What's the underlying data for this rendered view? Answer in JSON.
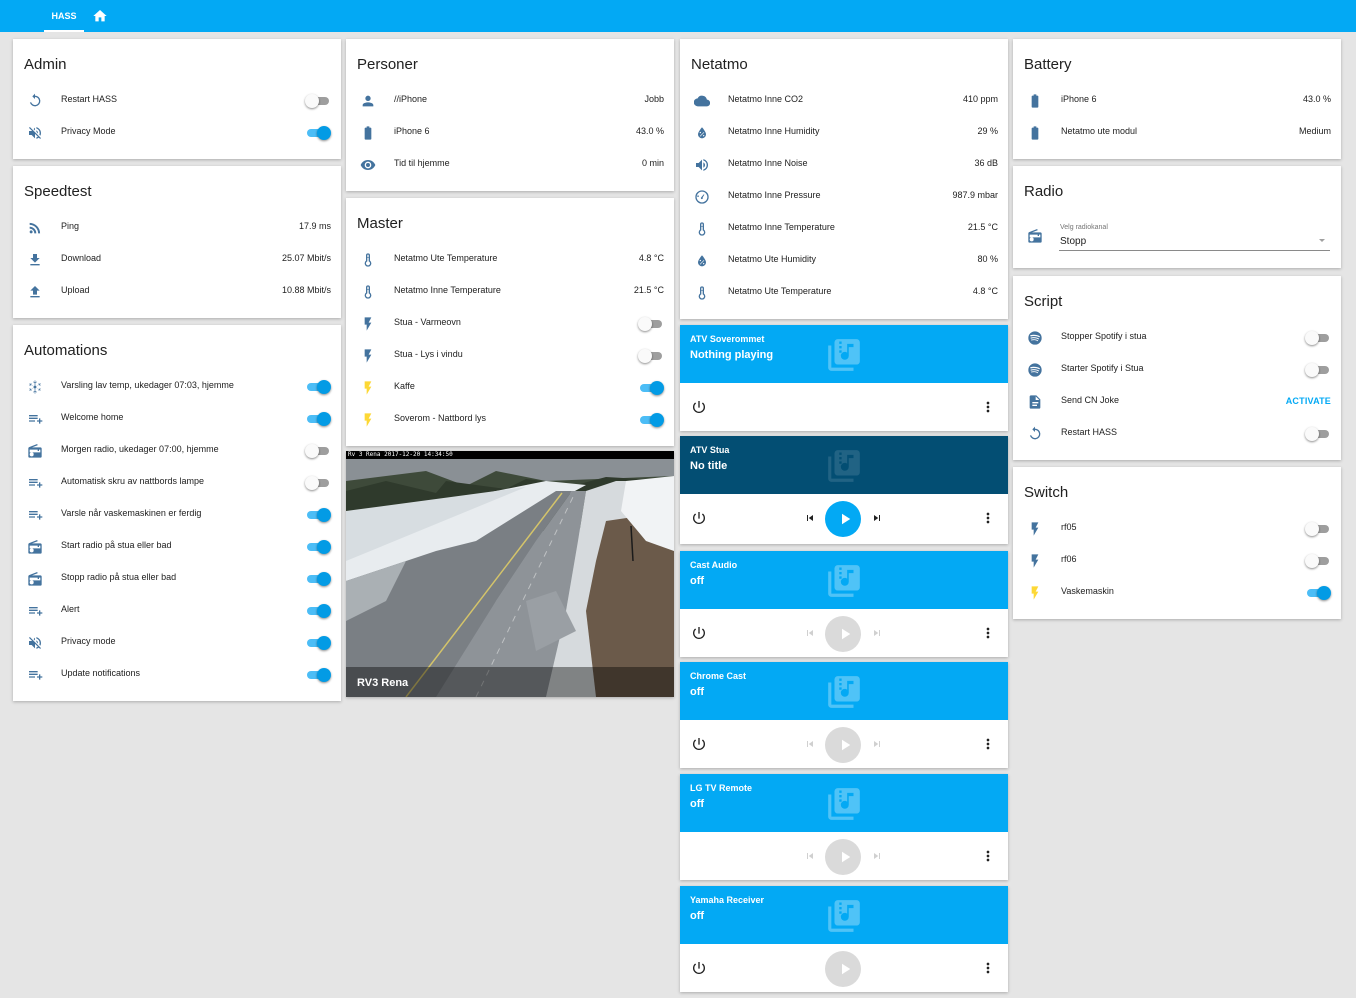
{
  "header": {
    "tab_label": "HASS",
    "home_icon": "home-icon",
    "bar_color": "#03a9f4"
  },
  "colors": {
    "icon": "#44739e",
    "accent": "#03a9f4",
    "toggle_on": "#039be5",
    "lightning_on": "#fdd835"
  },
  "admin": {
    "title": "Admin",
    "rows": [
      {
        "label": "Restart HASS",
        "icon": "restart-icon",
        "on": false
      },
      {
        "label": "Privacy Mode",
        "icon": "volume-off-icon",
        "on": true
      }
    ]
  },
  "speedtest": {
    "title": "Speedtest",
    "rows": [
      {
        "label": "Ping",
        "value": "17.9 ms",
        "icon": "rss-icon"
      },
      {
        "label": "Download",
        "value": "25.07 Mbit/s",
        "icon": "download-icon"
      },
      {
        "label": "Upload",
        "value": "10.88 Mbit/s",
        "icon": "upload-icon"
      }
    ]
  },
  "automations": {
    "title": "Automations",
    "rows": [
      {
        "label": "Varsling lav temp, ukedager 07:03, hjemme",
        "icon": "snowflake-icon",
        "on": true
      },
      {
        "label": "Welcome home",
        "icon": "playlist-icon",
        "on": true
      },
      {
        "label": "Morgen radio, ukedager 07:00, hjemme",
        "icon": "radio-icon",
        "on": false
      },
      {
        "label": "Automatisk skru av nattbords lampe",
        "icon": "playlist-icon",
        "on": false
      },
      {
        "label": "Varsle når vaskemaskinen er ferdig",
        "icon": "playlist-icon",
        "on": true
      },
      {
        "label": "Start radio på stua eller bad",
        "icon": "radio-icon",
        "on": true
      },
      {
        "label": "Stopp radio på stua eller bad",
        "icon": "radio-icon",
        "on": true
      },
      {
        "label": "Alert",
        "icon": "playlist-icon",
        "on": true
      },
      {
        "label": "Privacy mode",
        "icon": "volume-off-icon",
        "on": true
      },
      {
        "label": "Update notifications",
        "icon": "playlist-icon",
        "on": true
      }
    ]
  },
  "personer": {
    "title": "Personer",
    "rows": [
      {
        "label": "//iPhone",
        "value": "Jobb",
        "icon": "person-icon"
      },
      {
        "label": "iPhone 6",
        "value": "43.0 %",
        "icon": "battery-icon"
      },
      {
        "label": "Tid til hjemme",
        "value": "0 min",
        "icon": "eye-icon"
      }
    ]
  },
  "master": {
    "title": "Master",
    "rows": [
      {
        "label": "Netatmo Ute Temperature",
        "value": "4.8 °C",
        "icon": "thermometer-icon"
      },
      {
        "label": "Netatmo Inne Temperature",
        "value": "21.5 °C",
        "icon": "thermometer-icon"
      },
      {
        "label": "Stua - Varmeovn",
        "icon": "flash-icon",
        "on": false
      },
      {
        "label": "Stua - Lys i vindu",
        "icon": "flash-icon",
        "on": false
      },
      {
        "label": "Kaffe",
        "icon": "flash-icon",
        "on": true
      },
      {
        "label": "Soverom - Nattbord lys",
        "icon": "flash-icon",
        "on": true
      }
    ]
  },
  "camera": {
    "name": "RV3 Rena",
    "timestamp": "Rv 3 Rena  2017-12-20  14:34:50"
  },
  "netatmo": {
    "title": "Netatmo",
    "rows": [
      {
        "label": "Netatmo Inne CO2",
        "value": "410 ppm",
        "icon": "cloud-icon"
      },
      {
        "label": "Netatmo Inne Humidity",
        "value": "29 %",
        "icon": "water-percent-icon"
      },
      {
        "label": "Netatmo Inne Noise",
        "value": "36 dB",
        "icon": "volume-icon"
      },
      {
        "label": "Netatmo Inne Pressure",
        "value": "987.9 mbar",
        "icon": "gauge-icon"
      },
      {
        "label": "Netatmo Inne Temperature",
        "value": "21.5 °C",
        "icon": "thermometer-icon"
      },
      {
        "label": "Netatmo Ute Humidity",
        "value": "80 %",
        "icon": "water-percent-icon"
      },
      {
        "label": "Netatmo Ute Temperature",
        "value": "4.8 °C",
        "icon": "thermometer-icon"
      }
    ]
  },
  "media": [
    {
      "name": "ATV Soverommet",
      "state": "Nothing playing",
      "controls": "none",
      "dark": false
    },
    {
      "name": "ATV Stua",
      "state": "No title",
      "controls": "active",
      "dark": true
    },
    {
      "name": "Cast Audio",
      "state": "off",
      "controls": "disabled",
      "dark": false
    },
    {
      "name": "Chrome Cast",
      "state": "off",
      "controls": "disabled",
      "dark": false
    },
    {
      "name": "LG TV Remote",
      "state": "off",
      "controls": "disabled-nopower",
      "dark": false
    },
    {
      "name": "Yamaha Receiver",
      "state": "off",
      "controls": "play-only",
      "dark": false
    }
  ],
  "battery": {
    "title": "Battery",
    "rows": [
      {
        "label": "iPhone 6",
        "value": "43.0 %",
        "icon": "battery-icon"
      },
      {
        "label": "Netatmo ute modul",
        "value": "Medium",
        "icon": "battery-icon"
      }
    ]
  },
  "radio": {
    "title": "Radio",
    "select_label": "Velg radiokanal",
    "select_value": "Stopp",
    "icon": "radio-icon"
  },
  "script": {
    "title": "Script",
    "rows": [
      {
        "label": "Stopper Spotify i stua",
        "icon": "spotify-icon",
        "on": false
      },
      {
        "label": "Starter Spotify i Stua",
        "icon": "spotify-icon",
        "on": false
      },
      {
        "label": "Send CN Joke",
        "icon": "file-document-icon",
        "action": "ACTIVATE"
      },
      {
        "label": "Restart HASS",
        "icon": "restart-icon",
        "on": false
      }
    ]
  },
  "switch": {
    "title": "Switch",
    "rows": [
      {
        "label": "rf05",
        "icon": "flash-icon",
        "on": false
      },
      {
        "label": "rf06",
        "icon": "flash-icon",
        "on": false
      },
      {
        "label": "Vaskemaskin",
        "icon": "flash-icon",
        "on": true
      }
    ]
  }
}
